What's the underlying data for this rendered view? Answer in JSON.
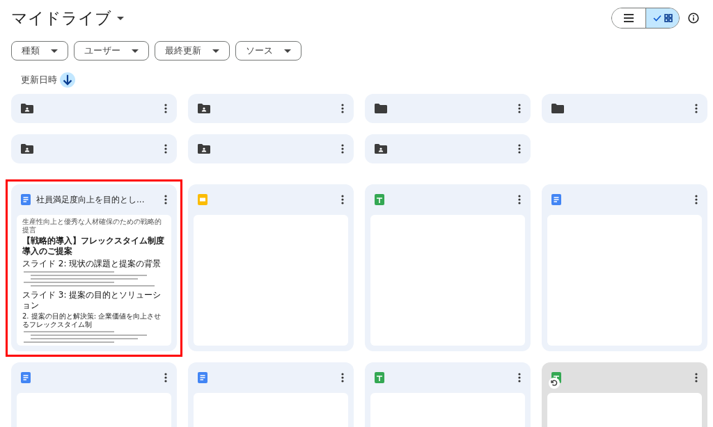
{
  "header": {
    "title": "マイドライブ",
    "view_toggle": [
      {
        "kind": "list",
        "selected": false
      },
      {
        "kind": "grid",
        "selected": true
      }
    ]
  },
  "filters": [
    {
      "label": "種類"
    },
    {
      "label": "ユーザー"
    },
    {
      "label": "最終更新"
    },
    {
      "label": "ソース"
    }
  ],
  "sort": {
    "label": "更新日時"
  },
  "folders": [
    {
      "kind": "shared"
    },
    {
      "kind": "shared"
    },
    {
      "kind": "plain"
    },
    {
      "kind": "plain"
    },
    {
      "kind": "shared"
    },
    {
      "kind": "shared"
    },
    {
      "kind": "shared"
    }
  ],
  "files": [
    {
      "kind": "doc",
      "title": "社員満足度向上を目的とし...",
      "highlighted": true,
      "dimmed": false,
      "preview": {
        "subtitle": "生産性向上と優秀な人材確保のための戦略的提言",
        "heading": "【戦略的導入】フレックスタイム制度導入のご提案",
        "sections": [
          {
            "title": "スライド 2: 現状の課題と提案の背景"
          },
          {
            "title": "スライド 3: 提案の目的とソリューション",
            "subheading": "2. 提案の目的と解決策: 企業価値を向上させるフレックスタイム制"
          }
        ]
      }
    },
    {
      "kind": "slides",
      "highlighted": false,
      "dimmed": false
    },
    {
      "kind": "sheet",
      "highlighted": false,
      "dimmed": false
    },
    {
      "kind": "doc",
      "highlighted": false,
      "dimmed": false
    },
    {
      "kind": "doc",
      "highlighted": false,
      "dimmed": false
    },
    {
      "kind": "doc",
      "highlighted": false,
      "dimmed": false
    },
    {
      "kind": "sheet",
      "highlighted": false,
      "dimmed": false
    },
    {
      "kind": "sheet",
      "highlighted": false,
      "dimmed": true
    }
  ]
}
